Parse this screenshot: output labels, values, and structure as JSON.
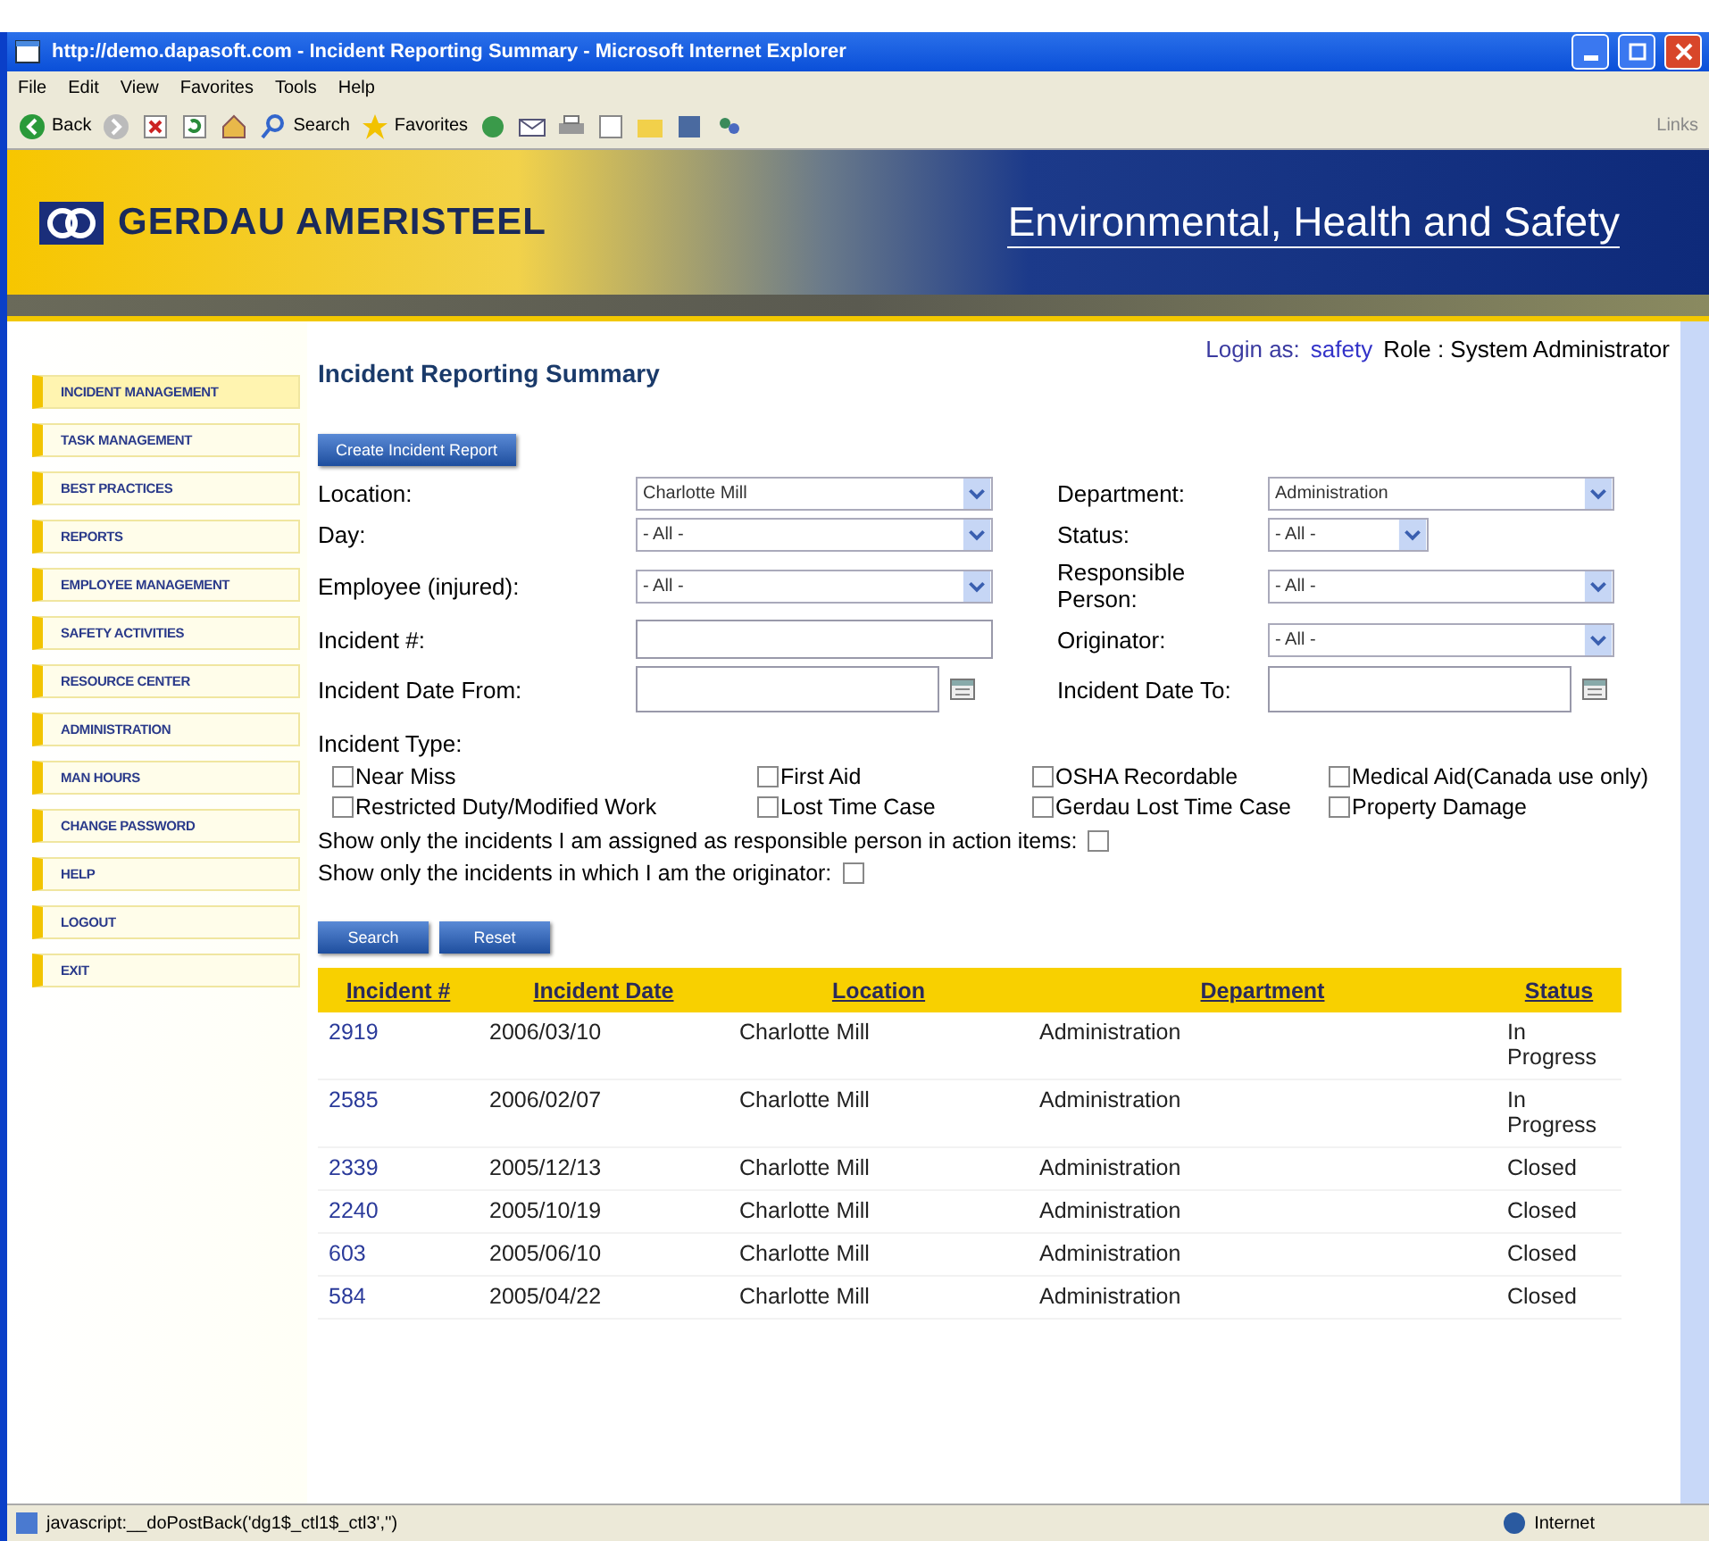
{
  "window": {
    "title": "http://demo.dapasoft.com - Incident Reporting Summary - Microsoft Internet Explorer"
  },
  "menu_bar": [
    "File",
    "Edit",
    "View",
    "Favorites",
    "Tools",
    "Help"
  ],
  "toolbar": {
    "back": "Back",
    "search": "Search",
    "favorites": "Favorites",
    "links": "Links"
  },
  "banner": {
    "company": "GERDAU AMERISTEEL",
    "subtitle": "Environmental, Health and Safety"
  },
  "sidebar": {
    "items": [
      {
        "label": "INCIDENT MANAGEMENT",
        "selected": true
      },
      {
        "label": "TASK MANAGEMENT",
        "selected": false
      },
      {
        "label": "BEST PRACTICES",
        "selected": false
      },
      {
        "label": "REPORTS",
        "selected": false
      },
      {
        "label": "EMPLOYEE MANAGEMENT",
        "selected": false
      },
      {
        "label": "SAFETY ACTIVITIES",
        "selected": false
      },
      {
        "label": "RESOURCE CENTER",
        "selected": false
      },
      {
        "label": "ADMINISTRATION",
        "selected": false
      },
      {
        "label": "MAN HOURS",
        "selected": false
      },
      {
        "label": "CHANGE PASSWORD",
        "selected": false
      },
      {
        "label": "HELP",
        "selected": false
      },
      {
        "label": "LOGOUT",
        "selected": false
      },
      {
        "label": "EXIT",
        "selected": false
      }
    ]
  },
  "user": {
    "login_label": "Login as:",
    "login_name": "safety",
    "role": "Role : System Administrator"
  },
  "page_title": "Incident Reporting Summary",
  "create_button": "Create Incident Report",
  "form": {
    "rows": [
      [
        {
          "label": "Location:",
          "kind": "select",
          "value": "Charlotte Mill"
        },
        {
          "label": "Department:",
          "kind": "select",
          "value": "Administration"
        }
      ],
      [
        {
          "label": "Day:",
          "kind": "select",
          "value": "- All -"
        },
        {
          "label": "Status:",
          "kind": "short_select",
          "value": "- All -"
        }
      ],
      [
        {
          "label": "Employee (injured):",
          "kind": "select",
          "value": "- All -"
        },
        {
          "label": "Responsible Person:",
          "kind": "select",
          "value": "- All -"
        }
      ],
      [
        {
          "label": "Incident #:",
          "kind": "text"
        },
        {
          "label": "Originator:",
          "kind": "select",
          "value": "- All -"
        }
      ],
      [
        {
          "label": "Incident Date From:",
          "kind": "date"
        },
        {
          "label": "Incident Date To:",
          "kind": "date"
        }
      ]
    ]
  },
  "incident_type": {
    "label": "Incident Type:",
    "options": [
      {
        "label": "Near Miss",
        "checked": false
      },
      {
        "label": "First Aid",
        "checked": false
      },
      {
        "label": "OSHA Recordable",
        "checked": false
      },
      {
        "label": "Medical Aid(Canada use only)",
        "checked": false
      },
      {
        "label": "Restricted Duty/Modified Work",
        "checked": false
      },
      {
        "label": "Lost Time Case",
        "checked": false
      },
      {
        "label": "Gerdau Lost Time Case",
        "checked": false
      },
      {
        "label": "Property Damage",
        "checked": false
      }
    ]
  },
  "filters": [
    {
      "label": "Show only the incidents I am assigned as responsible person in action items:",
      "checked": false
    },
    {
      "label": "Show only the incidents in which I am the originator:",
      "checked": false
    }
  ],
  "buttons": [
    "Search",
    "Reset"
  ],
  "table": {
    "columns": [
      "Incident #",
      "Incident Date",
      "Location",
      "Department",
      "Status"
    ],
    "rows": [
      [
        "2919",
        "2006/03/10",
        "Charlotte Mill",
        "Administration",
        "In Progress"
      ],
      [
        "2585",
        "2006/02/07",
        "Charlotte Mill",
        "Administration",
        "In Progress"
      ],
      [
        "2339",
        "2005/12/13",
        "Charlotte Mill",
        "Administration",
        "Closed"
      ],
      [
        "2240",
        "2005/10/19",
        "Charlotte Mill",
        "Administration",
        "Closed"
      ],
      [
        "603",
        "2005/06/10",
        "Charlotte Mill",
        "Administration",
        "Closed"
      ],
      [
        "584",
        "2005/04/22",
        "Charlotte Mill",
        "Administration",
        "Closed"
      ]
    ]
  },
  "status_bar": {
    "text": "javascript:__doPostBack('dg1$_ctl1$_ctl3','')",
    "zone": "Internet"
  }
}
